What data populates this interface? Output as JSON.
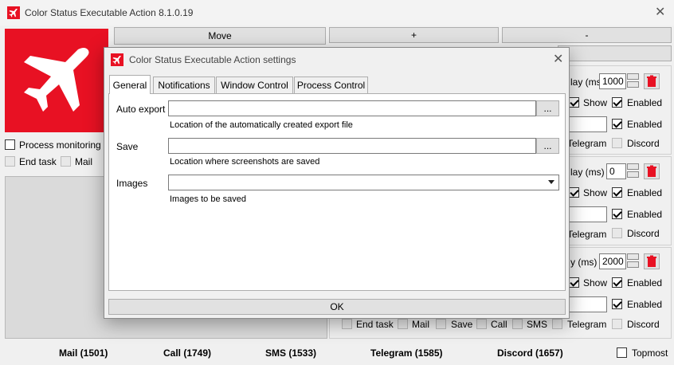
{
  "window": {
    "title": "Color Status Executable Action 8.1.0.19"
  },
  "main": {
    "move_label": "Move",
    "plus_label": "+",
    "minus_label": "-",
    "process_monitoring": "Process monitoring",
    "end_task": "End task",
    "mail": "Mail",
    "rows": [
      {
        "delay_label": "lay (ms)",
        "delay": "1000",
        "show": "Show",
        "enabled1": "Enabled",
        "enabled2": "Enabled",
        "telegram": "Telegram",
        "discord": "Discord"
      },
      {
        "delay_label": "lay (ms)",
        "delay": "0",
        "show": "Show",
        "enabled1": "Enabled",
        "enabled2": "Enabled",
        "telegram": "Telegram",
        "discord": "Discord"
      },
      {
        "delay_label": "y (ms)",
        "delay": "2000",
        "show": "Show",
        "enabled1": "Enabled",
        "enabled2": "Enabled"
      }
    ],
    "bottom_row": {
      "end_task": "End task",
      "mail": "Mail",
      "save": "Save",
      "call": "Call",
      "sms": "SMS",
      "telegram": "Telegram",
      "discord": "Discord"
    }
  },
  "status_bar": {
    "mail": "Mail (1501)",
    "call": "Call (1749)",
    "sms": "SMS (1533)",
    "telegram": "Telegram (1585)",
    "discord": "Discord (1657)",
    "topmost": "Topmost"
  },
  "dialog": {
    "title": "Color Status Executable Action settings",
    "tabs": [
      "General",
      "Notifications",
      "Window Control",
      "Process Control"
    ],
    "auto_export": {
      "label": "Auto export",
      "value": "",
      "browse": "...",
      "hint": "Location of the automatically created export file"
    },
    "save": {
      "label": "Save",
      "value": "",
      "browse": "...",
      "hint": "Location where screenshots are saved"
    },
    "images": {
      "label": "Images",
      "value": "",
      "hint": "Images to be saved"
    },
    "ok_label": "OK"
  },
  "colors": {
    "logo_red": "#e81123",
    "accent": "#0078d7"
  }
}
